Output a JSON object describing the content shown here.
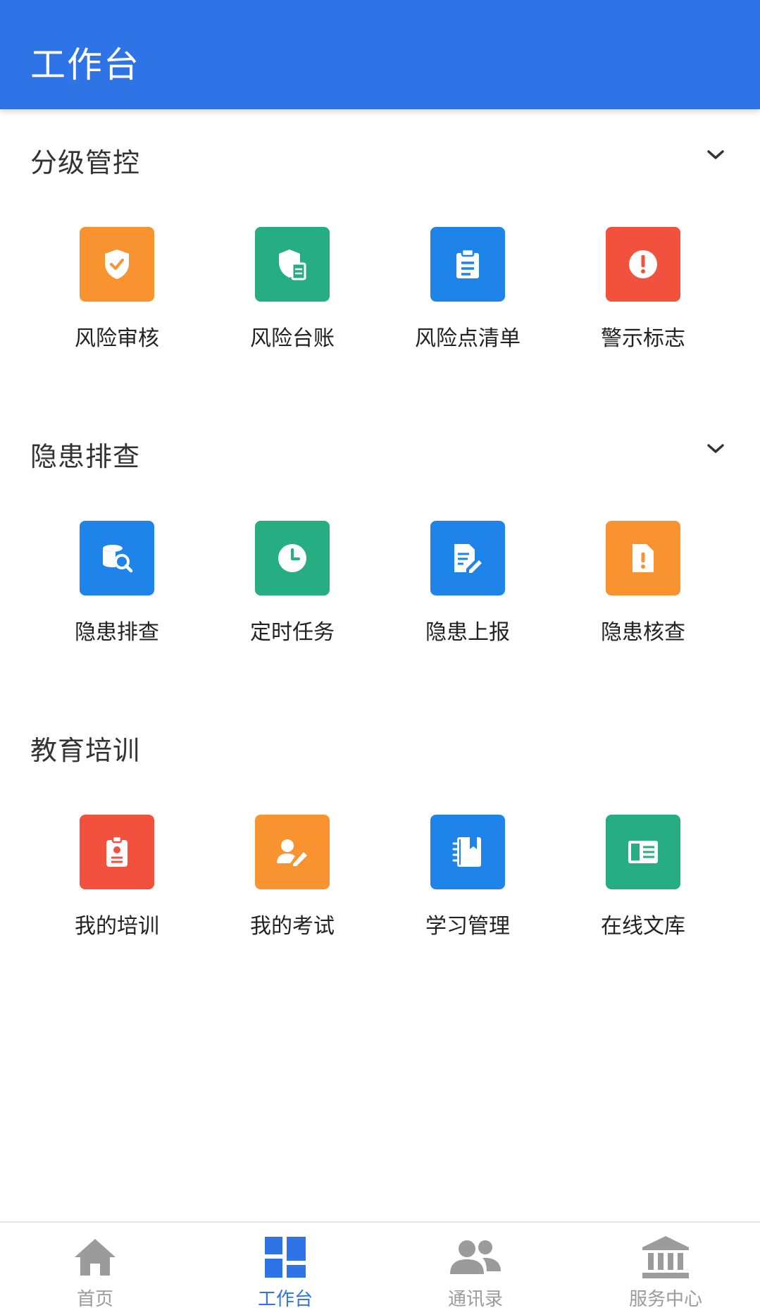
{
  "header": {
    "title": "工作台"
  },
  "colors": {
    "header_bg": "#2f74e6",
    "orange": "#f89330",
    "green": "#26ad82",
    "blue": "#1e84ea",
    "red": "#f2513e",
    "tab_active": "#2f74e6",
    "tab_inactive": "#9b9b9b"
  },
  "sections": [
    {
      "title": "分级管控",
      "collapsible_icon": "chevron-down-icon",
      "items": [
        {
          "label": "风险审核",
          "icon": "shield-check-icon",
          "color": "#f89330"
        },
        {
          "label": "风险台账",
          "icon": "shield-document-icon",
          "color": "#26ad82"
        },
        {
          "label": "风险点清单",
          "icon": "clipboard-list-icon",
          "color": "#1e84ea"
        },
        {
          "label": "警示标志",
          "icon": "warning-circle-icon",
          "color": "#f2513e"
        }
      ]
    },
    {
      "title": "隐患排查",
      "collapsible_icon": "chevron-down-icon",
      "items": [
        {
          "label": "隐患排查",
          "icon": "database-search-icon",
          "color": "#1e84ea"
        },
        {
          "label": "定时任务",
          "icon": "clock-icon",
          "color": "#26ad82"
        },
        {
          "label": "隐患上报",
          "icon": "document-edit-icon",
          "color": "#1e84ea"
        },
        {
          "label": "隐患核查",
          "icon": "document-alert-icon",
          "color": "#f89330"
        }
      ]
    },
    {
      "title": "教育培训",
      "items": [
        {
          "label": "我的培训",
          "icon": "id-badge-icon",
          "color": "#f2513e"
        },
        {
          "label": "我的考试",
          "icon": "user-edit-icon",
          "color": "#f89330"
        },
        {
          "label": "学习管理",
          "icon": "notebook-icon",
          "color": "#1e84ea"
        },
        {
          "label": "在线文库",
          "icon": "book-icon",
          "color": "#26ad82"
        }
      ]
    }
  ],
  "tabbar": {
    "active_index": 1,
    "tabs": [
      {
        "label": "首页",
        "icon": "home-icon"
      },
      {
        "label": "工作台",
        "icon": "dashboard-grid-icon"
      },
      {
        "label": "通讯录",
        "icon": "contacts-icon"
      },
      {
        "label": "服务中心",
        "icon": "bank-building-icon"
      }
    ]
  }
}
